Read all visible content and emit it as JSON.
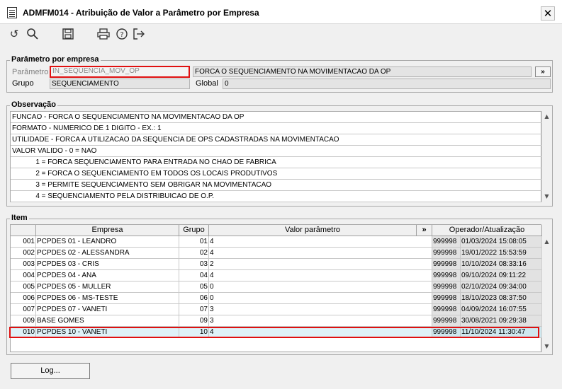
{
  "window": {
    "title": "ADMFM014 - Atribuição de Valor a Parâmetro por Empresa"
  },
  "toolbar": {
    "icons": [
      "undo-icon",
      "search-icon",
      "save-icon",
      "print-icon",
      "help-icon",
      "exit-icon"
    ]
  },
  "param_group": {
    "label": "Parâmetro por empresa",
    "parametro_label": "Parâmetro",
    "parametro_value": "IN_SEQUENCIA_MOV_OP",
    "parametro_desc": "FORCA O SEQUENCIAMENTO NA MOVIMENTACAO DA OP",
    "expand_label": "»",
    "grupo_label": "Grupo",
    "grupo_value": "SEQUENCIAMENTO",
    "global_label": "Global",
    "global_value": "0"
  },
  "observacao": {
    "label": "Observação",
    "lines": [
      "FUNCAO - FORCA O SEQUENCIAMENTO NA MOVIMENTACAO DA OP",
      "FORMATO - NUMERICO DE 1 DIGITO - EX.: 1",
      "UTILIDADE - FORCA A UTILIZACAO DA SEQUENCIA DE OPS CADASTRADAS NA MOVIMENTACAO",
      "VALOR VALIDO - 0 = NAO",
      "            1 = FORCA SEQUENCIAMENTO PARA ENTRADA NO CHAO DE FABRICA",
      "            2 = FORCA O SEQUENCIAMENTO EM TODOS OS LOCAIS PRODUTIVOS",
      "            3 = PERMITE SEQUENCIAMENTO SEM OBRIGAR NA MOVIMENTACAO",
      "            4 = SEQUENCIAMENTO PELA DISTRIBUICAO DE O.P."
    ]
  },
  "item": {
    "label": "Item",
    "headers": {
      "empresa": "Empresa",
      "grupo": "Grupo",
      "valor": "Valor parâmetro",
      "expand": "»",
      "operador": "Operador/Atualização"
    },
    "rows": [
      {
        "code": "001",
        "empresa": "PCPDES 01 - LEANDRO",
        "grupo": "01",
        "valor": "4",
        "operador": "999998",
        "data": "01/03/2024 15:08:05"
      },
      {
        "code": "002",
        "empresa": "PCPDES 02 - ALESSANDRA",
        "grupo": "02",
        "valor": "4",
        "operador": "999998",
        "data": "19/01/2022 15:53:59"
      },
      {
        "code": "003",
        "empresa": "PCPDES 03 - CRIS",
        "grupo": "03",
        "valor": "2",
        "operador": "999998",
        "data": "10/10/2024 08:33:16"
      },
      {
        "code": "004",
        "empresa": "PCPDES 04 - ANA",
        "grupo": "04",
        "valor": "4",
        "operador": "999998",
        "data": "09/10/2024 09:11:22"
      },
      {
        "code": "005",
        "empresa": "PCPDES 05 - MULLER",
        "grupo": "05",
        "valor": "0",
        "operador": "999998",
        "data": "02/10/2024 09:34:00"
      },
      {
        "code": "006",
        "empresa": "PCPDES 06 - MS-TESTE",
        "grupo": "06",
        "valor": "0",
        "operador": "999998",
        "data": "18/10/2023 08:37:50"
      },
      {
        "code": "007",
        "empresa": "PCPDES 07 - VANETI",
        "grupo": "07",
        "valor": "3",
        "operador": "999998",
        "data": "04/09/2024 16:07:55"
      },
      {
        "code": "009",
        "empresa": "BASE GOMES",
        "grupo": "09",
        "valor": "3",
        "operador": "999998",
        "data": "30/08/2021 09:29:38"
      },
      {
        "code": "010",
        "empresa": "PCPDES 10 - VANETI",
        "grupo": "10",
        "valor": "4",
        "operador": "999998",
        "data": "11/10/2024 11:30:47"
      }
    ],
    "selected_index": 8
  },
  "footer": {
    "log_label": "Log..."
  }
}
